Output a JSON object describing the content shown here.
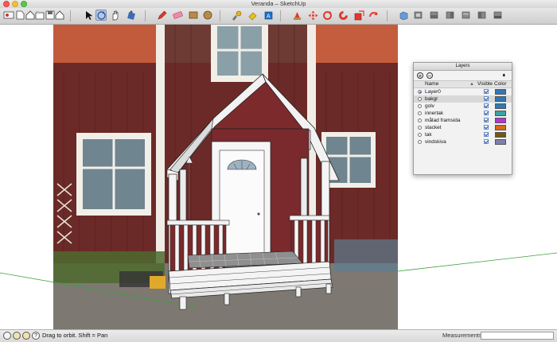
{
  "window": {
    "title": "Veranda – SketchUp"
  },
  "toolbar": {
    "icons": [
      "getting-started",
      "new",
      "open",
      "save",
      "cut",
      "copy",
      "paste",
      "select",
      "orbit",
      "pan",
      "zoom",
      "pencil",
      "eraser",
      "rectangle",
      "circle",
      "push-pull",
      "paint",
      "move",
      "rotate",
      "scale",
      "offset",
      "follow-me",
      "iso",
      "top",
      "front",
      "right",
      "back",
      "left"
    ]
  },
  "layers_panel": {
    "title": "Layers",
    "col_name": "Name",
    "col_visible": "Visible",
    "col_color": "Color",
    "items": [
      {
        "name": "Layer0",
        "active": true,
        "selected": false,
        "visible": true,
        "color": "#2f77b5"
      },
      {
        "name": "bakgr",
        "active": false,
        "selected": true,
        "visible": true,
        "color": "#2f77b5"
      },
      {
        "name": "golv",
        "active": false,
        "selected": false,
        "visible": true,
        "color": "#2f77b5"
      },
      {
        "name": "innertak",
        "active": false,
        "selected": false,
        "visible": true,
        "color": "#3aa3a3"
      },
      {
        "name": "målad framsida",
        "active": false,
        "selected": false,
        "visible": true,
        "color": "#b335d6"
      },
      {
        "name": "stacket",
        "active": false,
        "selected": false,
        "visible": true,
        "color": "#d86a14"
      },
      {
        "name": "tak",
        "active": false,
        "selected": false,
        "visible": true,
        "color": "#6e5a12"
      },
      {
        "name": "vindskiva",
        "active": false,
        "selected": false,
        "visible": true,
        "color": "#7f7fb0"
      }
    ]
  },
  "status": {
    "hint": "Drag to orbit.  Shift = Pan",
    "measurements_label": "Measurements",
    "measurements_value": ""
  }
}
